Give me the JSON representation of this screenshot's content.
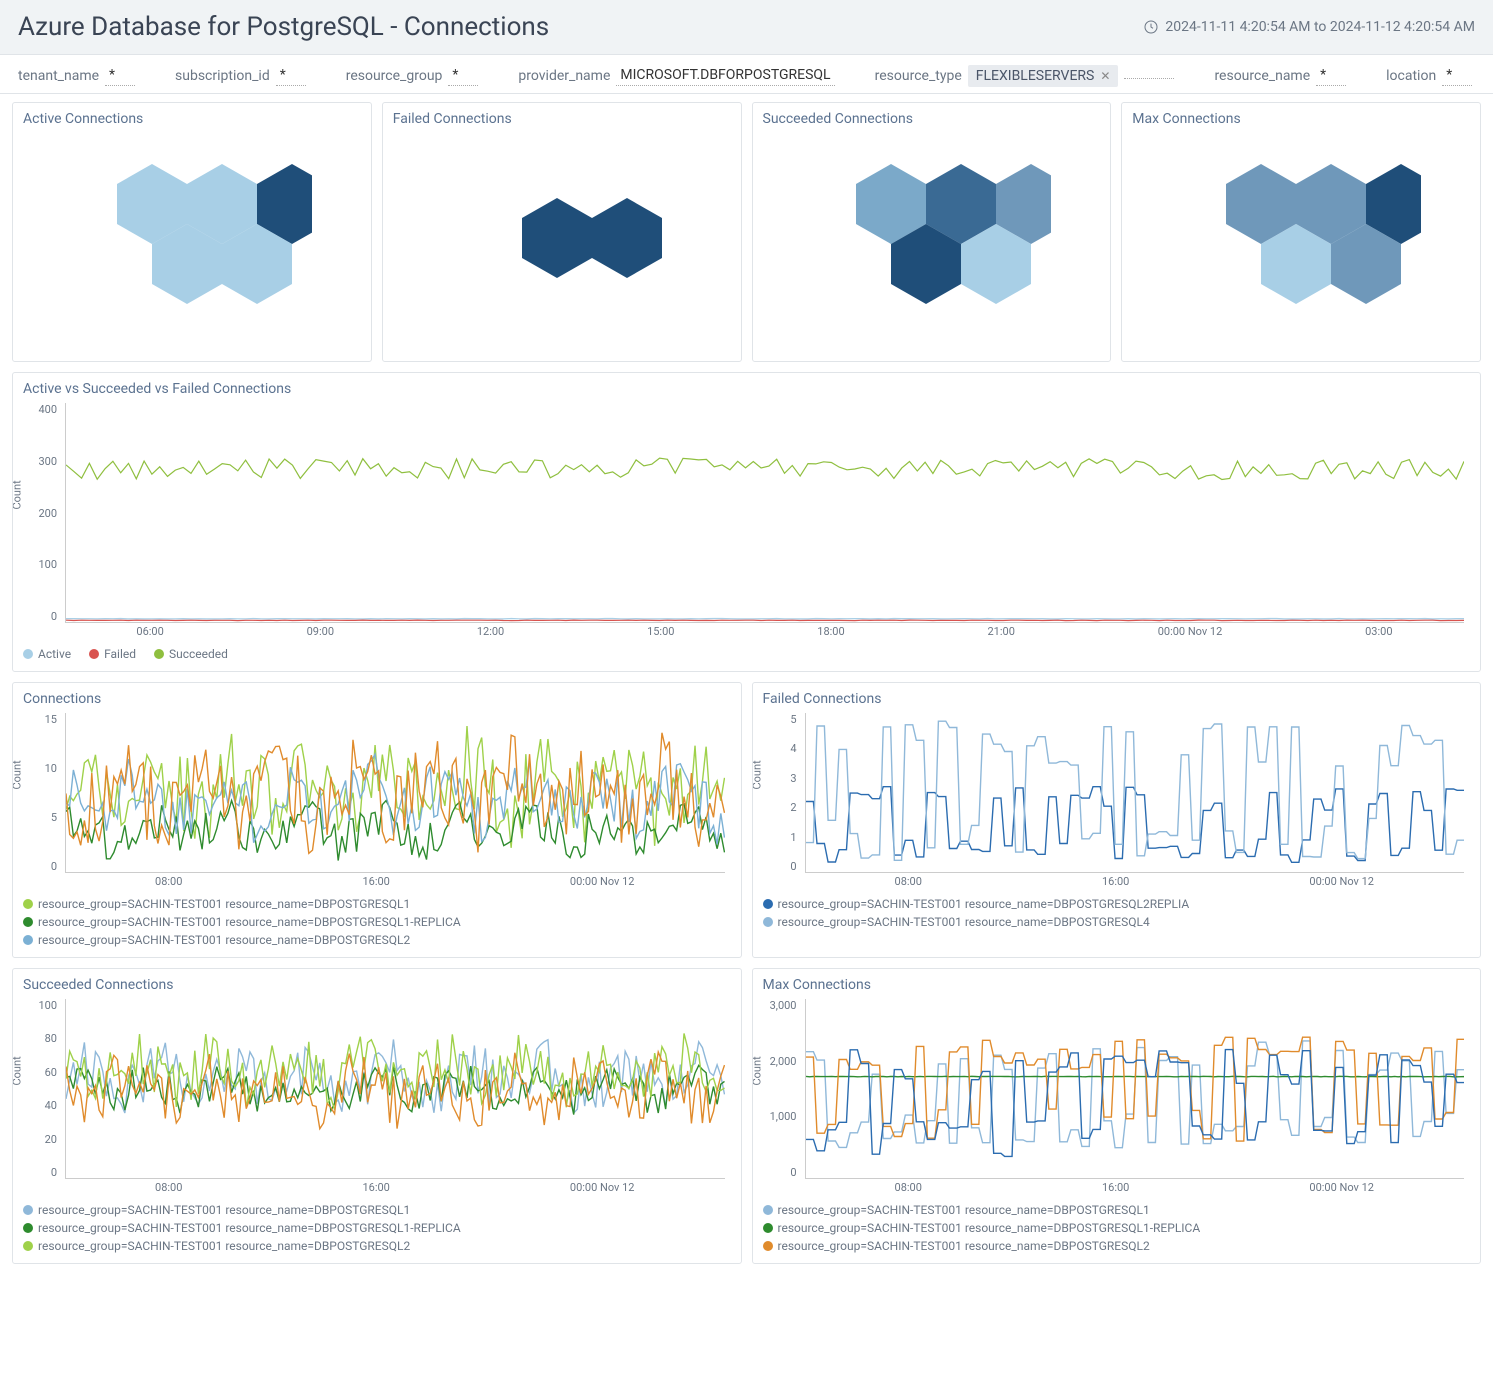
{
  "header": {
    "title": "Azure Database for PostgreSQL - Connections",
    "timestamp": "2024-11-11 4:20:54 AM to 2024-11-12 4:20:54 AM"
  },
  "filters": {
    "tenant_name": {
      "label": "tenant_name",
      "value": "*"
    },
    "subscription_id": {
      "label": "subscription_id",
      "value": "*"
    },
    "resource_group": {
      "label": "resource_group",
      "value": "*"
    },
    "provider_name": {
      "label": "provider_name",
      "value": "MICROSOFT.DBFORPOSTGRESQL"
    },
    "resource_type": {
      "label": "resource_type",
      "chip": "FLEXIBLESERVERS"
    },
    "resource_name": {
      "label": "resource_name",
      "value": "*"
    },
    "location": {
      "label": "location",
      "value": "*"
    }
  },
  "panels": {
    "active_connections": "Active Connections",
    "failed_connections": "Failed Connections",
    "succeeded_connections": "Succeeded Connections",
    "max_connections": "Max Connections",
    "avsf": "Active vs Succeeded vs Failed Connections",
    "connections": "Connections",
    "failed2": "Failed Connections",
    "succeeded2": "Succeeded Connections",
    "max2": "Max Connections"
  },
  "chart_data": [
    {
      "id": "avsf",
      "type": "line",
      "ylabel": "Count",
      "ylim": [
        0,
        400
      ],
      "x_ticks": [
        "06:00",
        "09:00",
        "12:00",
        "15:00",
        "18:00",
        "21:00",
        "00:00 Nov 12",
        "03:00"
      ],
      "series": [
        {
          "name": "Active",
          "color": "#a8cfe6",
          "approx": "flat_low",
          "level": 6
        },
        {
          "name": "Failed",
          "color": "#d9534f",
          "approx": "flat_low",
          "level": 3
        },
        {
          "name": "Succeeded",
          "color": "#8fbf3f",
          "approx": "noisy_flat",
          "level": 280,
          "jitter": 20
        }
      ]
    },
    {
      "id": "connections",
      "type": "line",
      "ylabel": "Count",
      "ylim": [
        0,
        15
      ],
      "x_ticks": [
        "08:00",
        "16:00",
        "00:00 Nov 12"
      ],
      "series": [
        {
          "name": "resource_group=SACHIN-TEST001 resource_name=DBPOSTGRESQL1",
          "color": "#9fd14a",
          "approx": "noisy",
          "level": 8,
          "jitter": 4
        },
        {
          "name": "resource_group=SACHIN-TEST001 resource_name=DBPOSTGRESQL1-REPLICA",
          "color": "#2e8b2e",
          "approx": "noisy",
          "level": 4,
          "jitter": 2
        },
        {
          "name": "resource_group=SACHIN-TEST001 resource_name=DBPOSTGRESQL2",
          "color": "#7bb0d4",
          "approx": "noisy",
          "level": 7,
          "jitter": 3
        }
      ],
      "extra_series_color": "#e08b2c"
    },
    {
      "id": "failed2",
      "type": "line",
      "ylabel": "Count",
      "ylim": [
        0,
        5
      ],
      "x_ticks": [
        "08:00",
        "16:00",
        "00:00 Nov 12"
      ],
      "series": [
        {
          "name": "resource_group=SACHIN-TEST001 resource_name=DBPOSTGRESQL2REPLIA",
          "color": "#2b6cb0",
          "approx": "square",
          "level": 1.5,
          "jitter": 0.8
        },
        {
          "name": "resource_group=SACHIN-TEST001 resource_name=DBPOSTGRESQL4",
          "color": "#8fb8d9",
          "approx": "square",
          "level": 2.5,
          "jitter": 1.5
        }
      ]
    },
    {
      "id": "succeeded2",
      "type": "line",
      "ylabel": "Count",
      "ylim": [
        0,
        100
      ],
      "x_ticks": [
        "08:00",
        "16:00",
        "00:00 Nov 12"
      ],
      "series": [
        {
          "name": "resource_group=SACHIN-TEST001 resource_name=DBPOSTGRESQL1",
          "color": "#8fb8d9",
          "approx": "noisy",
          "level": 55,
          "jitter": 15
        },
        {
          "name": "resource_group=SACHIN-TEST001 resource_name=DBPOSTGRESQL1-REPLICA",
          "color": "#2e8b2e",
          "approx": "noisy",
          "level": 50,
          "jitter": 10
        },
        {
          "name": "resource_group=SACHIN-TEST001 resource_name=DBPOSTGRESQL2",
          "color": "#9fd14a",
          "approx": "noisy",
          "level": 60,
          "jitter": 15
        }
      ],
      "extra_series_color": "#e08b2c"
    },
    {
      "id": "max2",
      "type": "line",
      "ylabel": "Count",
      "ylim": [
        0,
        3000
      ],
      "x_ticks": [
        "08:00",
        "16:00",
        "00:00 Nov 12"
      ],
      "series": [
        {
          "name": "resource_group=SACHIN-TEST001 resource_name=DBPOSTGRESQL1",
          "color": "#8fb8d9",
          "approx": "square",
          "level": 1400,
          "jitter": 600
        },
        {
          "name": "resource_group=SACHIN-TEST001 resource_name=DBPOSTGRESQL1-REPLICA",
          "color": "#2e8b2e",
          "approx": "flat",
          "level": 1700,
          "jitter": 20
        },
        {
          "name": "resource_group=SACHIN-TEST001 resource_name=DBPOSTGRESQL2",
          "color": "#e08b2c",
          "approx": "square",
          "level": 1500,
          "jitter": 600
        }
      ],
      "extra_series_color": "#2b6cb0"
    }
  ]
}
